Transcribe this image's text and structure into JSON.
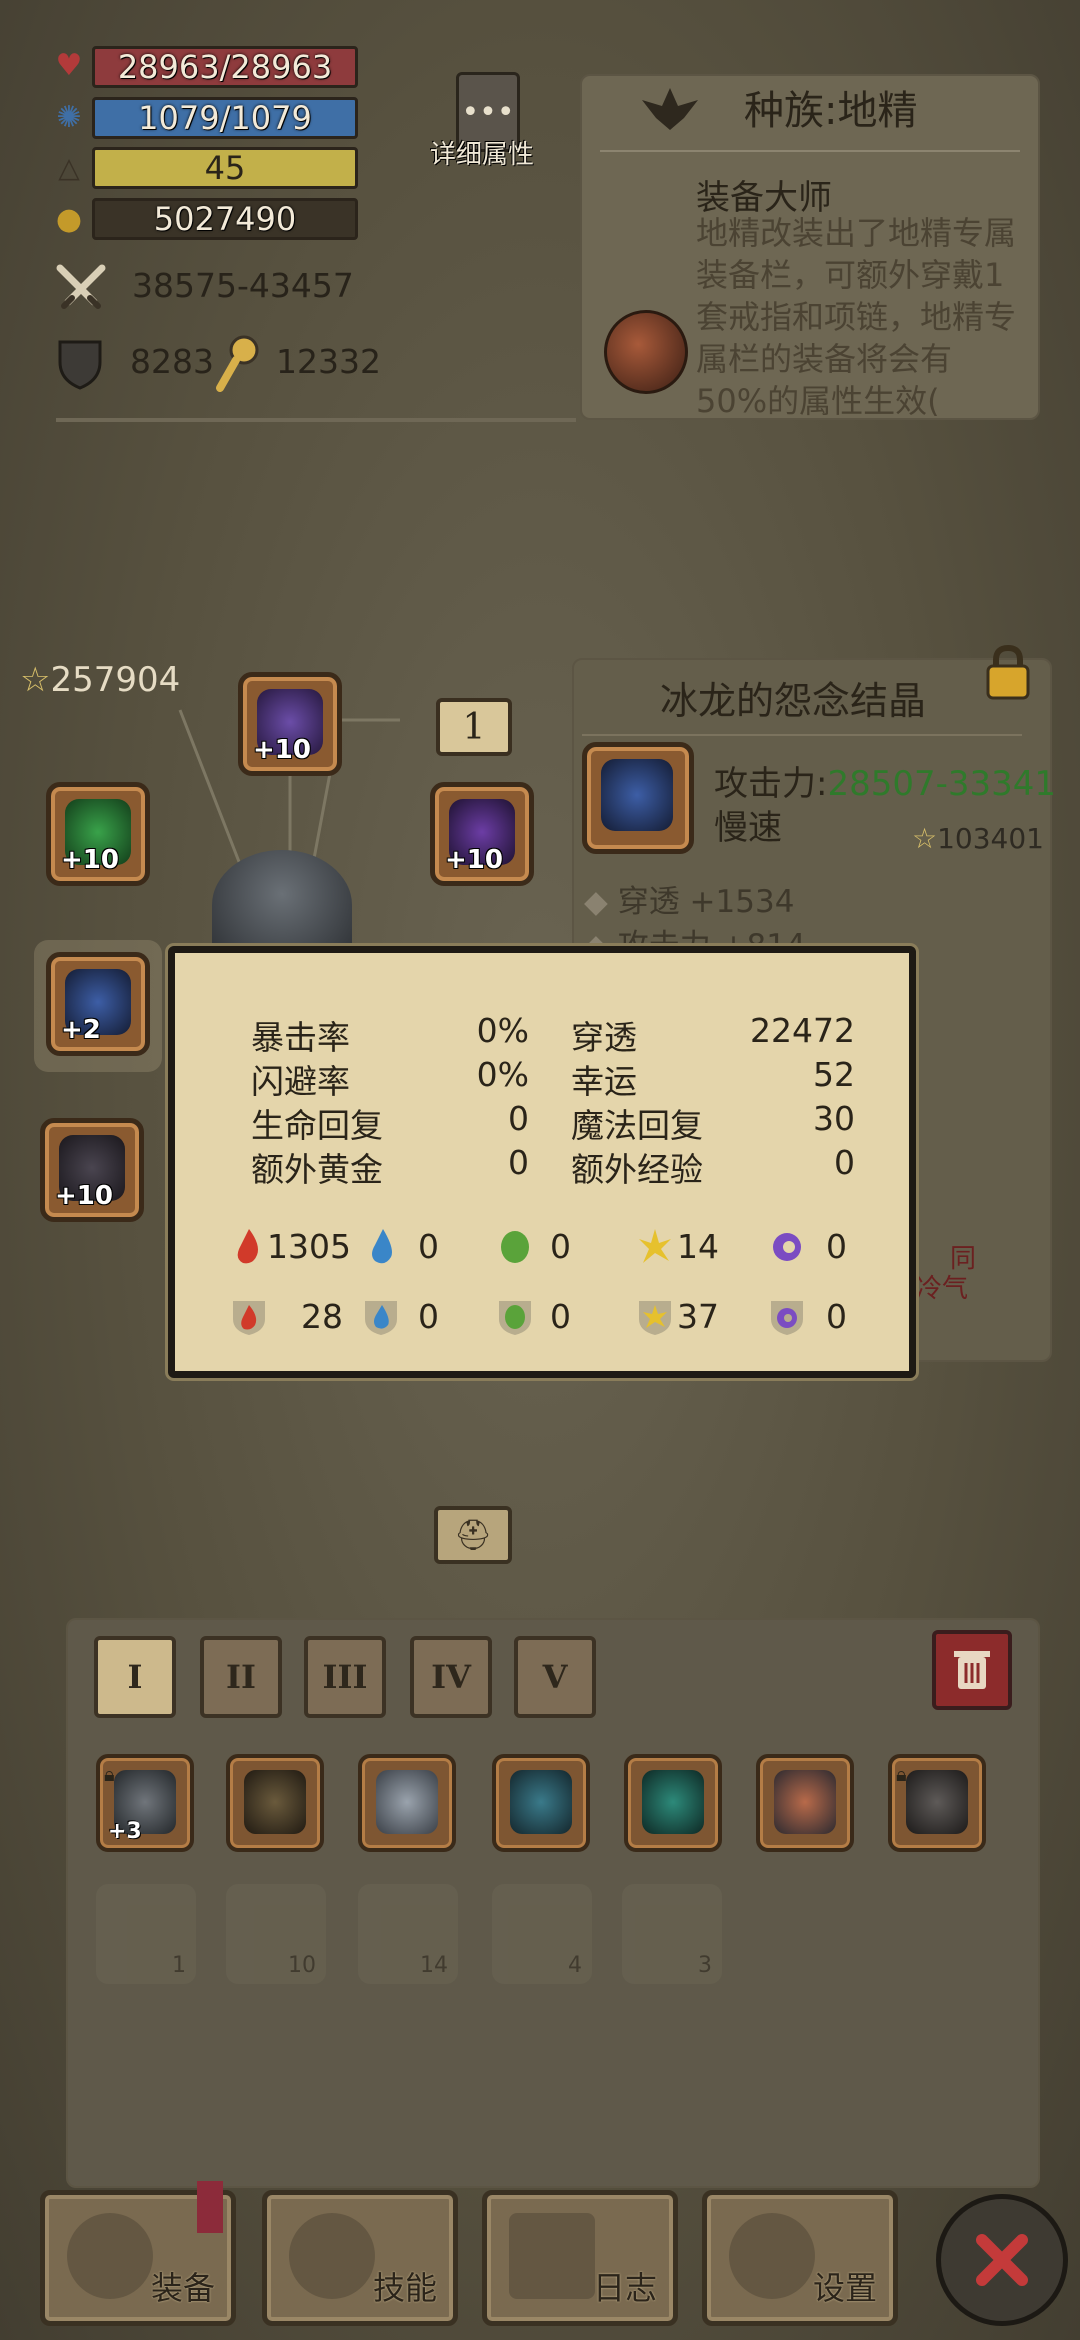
{
  "stats": {
    "hp": "28963/28963",
    "mp": "1079/1079",
    "level": "45",
    "gold": "5027490",
    "attack": "38575-43457",
    "defense": "8283",
    "magic_defense": "12332",
    "details_label": "详细属性"
  },
  "race": {
    "title": "种族:地精",
    "skill_name": "装备大师",
    "skill_desc": "地精改装出了地精专属装备栏，可额外穿戴1套戒指和项链，地精专属栏的装备将会有50%的属性生效("
  },
  "equipment": {
    "score": "257904",
    "slot_number": "1",
    "slots": [
      {
        "level": "+10"
      },
      {
        "level": "+10"
      },
      {
        "level": "+10"
      },
      {
        "level": "+2"
      },
      {
        "level": "+10"
      }
    ]
  },
  "item": {
    "name": "冰龙的怨念结晶",
    "attack_label": "攻击力:",
    "attack_value": "28507-33341",
    "speed": "慢速",
    "score": "103401",
    "attr1": "穿透 +1534",
    "attr2": "攻击力 +814",
    "side_text1": "同",
    "side_text2": "冷气"
  },
  "popup": {
    "rows": [
      {
        "l1": "暴击率",
        "v1": "0%",
        "l2": "穿透",
        "v2": "22472"
      },
      {
        "l1": "闪避率",
        "v1": "0%",
        "l2": "幸运",
        "v2": "52"
      },
      {
        "l1": "生命回复",
        "v1": "0",
        "l2": "魔法回复",
        "v2": "30"
      },
      {
        "l1": "额外黄金",
        "v1": "0",
        "l2": "额外经验",
        "v2": "0"
      }
    ],
    "element_attack": [
      "1305",
      "0",
      "0",
      "14",
      "0"
    ],
    "element_resist": [
      "28",
      "0",
      "0",
      "37",
      "0"
    ]
  },
  "colors": {
    "hp_bar": "#8e3b3d",
    "mp_bar": "#3f6fa6",
    "lvl_bar": "#c2b04a",
    "gold_bar": "#3a3327",
    "green_text": "#2f7a2b",
    "fire": "#d13a2a",
    "water": "#3a86c8",
    "wind": "#5aa33a",
    "light": "#e6c12d",
    "dark": "#7b4cc2"
  },
  "inventory": {
    "tabs": [
      "I",
      "II",
      "III",
      "IV",
      "V"
    ],
    "items": [
      {
        "level": "+3"
      },
      {
        "level": ""
      },
      {
        "level": ""
      },
      {
        "level": ""
      },
      {
        "level": ""
      },
      {
        "level": ""
      },
      {
        "level": ""
      }
    ],
    "consumables": [
      {
        "count": "1"
      },
      {
        "count": "10"
      },
      {
        "count": "14"
      },
      {
        "count": "4"
      },
      {
        "count": "3"
      }
    ]
  },
  "nav": {
    "equip": "装备",
    "skills": "技能",
    "log": "日志",
    "settings": "设置"
  }
}
